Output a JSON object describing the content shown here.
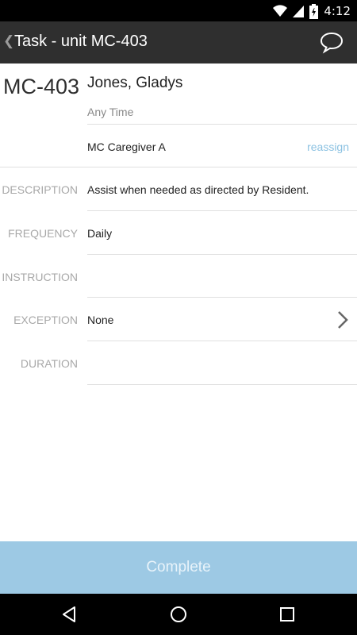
{
  "status_bar": {
    "time": "4:12",
    "icons": [
      "wifi-icon",
      "signal-icon",
      "battery-icon"
    ]
  },
  "action_bar": {
    "back_glyph": "❮",
    "title": "Task - unit MC-403",
    "chat_icon": "speech-bubble-icon"
  },
  "task": {
    "unit": "MC-403",
    "resident_name": "Jones, Gladys",
    "schedule": "Any Time",
    "caregiver": "MC Caregiver A",
    "reassign_label": "reassign"
  },
  "details": {
    "description_label": "DESCRIPTION",
    "description_value": "Assist when needed as directed by Resident.",
    "frequency_label": "FREQUENCY",
    "frequency_value": "Daily",
    "instruction_label": "INSTRUCTION",
    "instruction_value": "",
    "exception_label": "EXCEPTION",
    "exception_value": "None",
    "duration_label": "DURATION",
    "duration_value": ""
  },
  "complete_label": "Complete",
  "colors": {
    "action_bar": "#2f2f2f",
    "accent_link": "#8cc2e2",
    "complete_button": "#9dc9e4",
    "label_gray": "#a8a8a8"
  },
  "nav_bar": {
    "icons": [
      "back-triangle-icon",
      "home-circle-icon",
      "recents-square-icon"
    ]
  }
}
